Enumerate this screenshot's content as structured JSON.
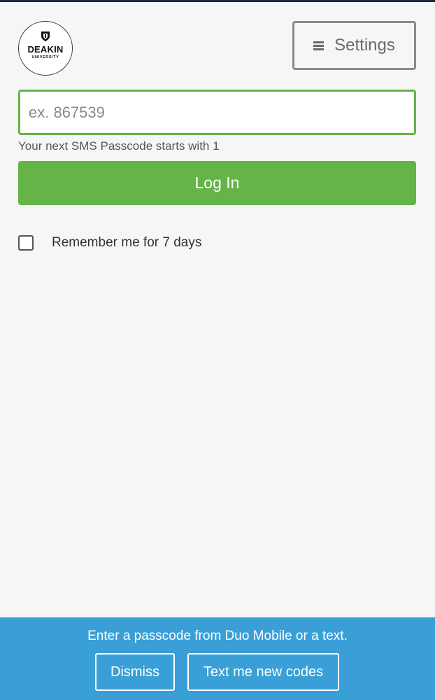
{
  "logo": {
    "name": "DEAKIN",
    "subtitle": "UNIVERSITY",
    "icon": "crest-icon"
  },
  "settings": {
    "label": "Settings",
    "icon": "menu-icon"
  },
  "passcode": {
    "placeholder": "ex. 867539",
    "value": "",
    "hint": "Your next SMS Passcode starts with 1"
  },
  "login": {
    "label": "Log In"
  },
  "remember": {
    "label": "Remember me for 7 days",
    "checked": false
  },
  "notice": {
    "message": "Enter a passcode from Duo Mobile or a text.",
    "dismiss_label": "Dismiss",
    "text_codes_label": "Text me new codes"
  },
  "colors": {
    "accent_green": "#65b447",
    "notice_blue": "#3a9fd6",
    "background": "#f6f6f6",
    "settings_border": "#8a8a8a"
  }
}
